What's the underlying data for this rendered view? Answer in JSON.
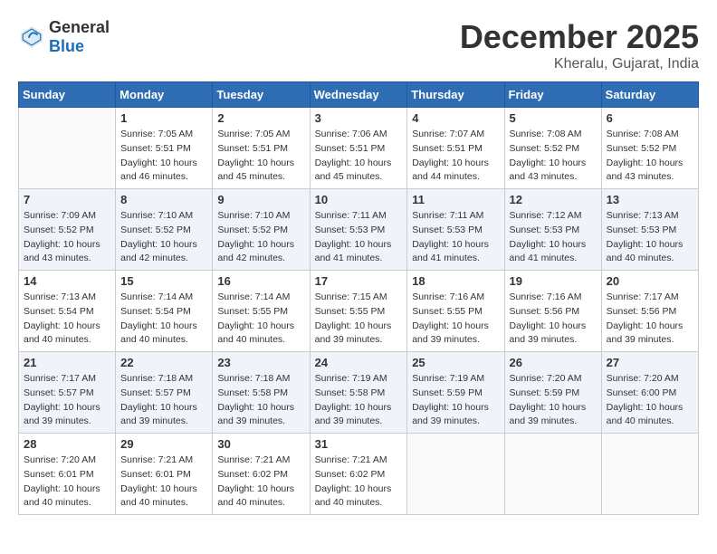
{
  "header": {
    "logo_general": "General",
    "logo_blue": "Blue",
    "month_year": "December 2025",
    "location": "Kheralu, Gujarat, India"
  },
  "days_of_week": [
    "Sunday",
    "Monday",
    "Tuesday",
    "Wednesday",
    "Thursday",
    "Friday",
    "Saturday"
  ],
  "weeks": [
    [
      {
        "day": "",
        "info": ""
      },
      {
        "day": "1",
        "info": "Sunrise: 7:05 AM\nSunset: 5:51 PM\nDaylight: 10 hours\nand 46 minutes."
      },
      {
        "day": "2",
        "info": "Sunrise: 7:05 AM\nSunset: 5:51 PM\nDaylight: 10 hours\nand 45 minutes."
      },
      {
        "day": "3",
        "info": "Sunrise: 7:06 AM\nSunset: 5:51 PM\nDaylight: 10 hours\nand 45 minutes."
      },
      {
        "day": "4",
        "info": "Sunrise: 7:07 AM\nSunset: 5:51 PM\nDaylight: 10 hours\nand 44 minutes."
      },
      {
        "day": "5",
        "info": "Sunrise: 7:08 AM\nSunset: 5:52 PM\nDaylight: 10 hours\nand 43 minutes."
      },
      {
        "day": "6",
        "info": "Sunrise: 7:08 AM\nSunset: 5:52 PM\nDaylight: 10 hours\nand 43 minutes."
      }
    ],
    [
      {
        "day": "7",
        "info": "Sunrise: 7:09 AM\nSunset: 5:52 PM\nDaylight: 10 hours\nand 43 minutes."
      },
      {
        "day": "8",
        "info": "Sunrise: 7:10 AM\nSunset: 5:52 PM\nDaylight: 10 hours\nand 42 minutes."
      },
      {
        "day": "9",
        "info": "Sunrise: 7:10 AM\nSunset: 5:52 PM\nDaylight: 10 hours\nand 42 minutes."
      },
      {
        "day": "10",
        "info": "Sunrise: 7:11 AM\nSunset: 5:53 PM\nDaylight: 10 hours\nand 41 minutes."
      },
      {
        "day": "11",
        "info": "Sunrise: 7:11 AM\nSunset: 5:53 PM\nDaylight: 10 hours\nand 41 minutes."
      },
      {
        "day": "12",
        "info": "Sunrise: 7:12 AM\nSunset: 5:53 PM\nDaylight: 10 hours\nand 41 minutes."
      },
      {
        "day": "13",
        "info": "Sunrise: 7:13 AM\nSunset: 5:53 PM\nDaylight: 10 hours\nand 40 minutes."
      }
    ],
    [
      {
        "day": "14",
        "info": "Sunrise: 7:13 AM\nSunset: 5:54 PM\nDaylight: 10 hours\nand 40 minutes."
      },
      {
        "day": "15",
        "info": "Sunrise: 7:14 AM\nSunset: 5:54 PM\nDaylight: 10 hours\nand 40 minutes."
      },
      {
        "day": "16",
        "info": "Sunrise: 7:14 AM\nSunset: 5:55 PM\nDaylight: 10 hours\nand 40 minutes."
      },
      {
        "day": "17",
        "info": "Sunrise: 7:15 AM\nSunset: 5:55 PM\nDaylight: 10 hours\nand 39 minutes."
      },
      {
        "day": "18",
        "info": "Sunrise: 7:16 AM\nSunset: 5:55 PM\nDaylight: 10 hours\nand 39 minutes."
      },
      {
        "day": "19",
        "info": "Sunrise: 7:16 AM\nSunset: 5:56 PM\nDaylight: 10 hours\nand 39 minutes."
      },
      {
        "day": "20",
        "info": "Sunrise: 7:17 AM\nSunset: 5:56 PM\nDaylight: 10 hours\nand 39 minutes."
      }
    ],
    [
      {
        "day": "21",
        "info": "Sunrise: 7:17 AM\nSunset: 5:57 PM\nDaylight: 10 hours\nand 39 minutes."
      },
      {
        "day": "22",
        "info": "Sunrise: 7:18 AM\nSunset: 5:57 PM\nDaylight: 10 hours\nand 39 minutes."
      },
      {
        "day": "23",
        "info": "Sunrise: 7:18 AM\nSunset: 5:58 PM\nDaylight: 10 hours\nand 39 minutes."
      },
      {
        "day": "24",
        "info": "Sunrise: 7:19 AM\nSunset: 5:58 PM\nDaylight: 10 hours\nand 39 minutes."
      },
      {
        "day": "25",
        "info": "Sunrise: 7:19 AM\nSunset: 5:59 PM\nDaylight: 10 hours\nand 39 minutes."
      },
      {
        "day": "26",
        "info": "Sunrise: 7:20 AM\nSunset: 5:59 PM\nDaylight: 10 hours\nand 39 minutes."
      },
      {
        "day": "27",
        "info": "Sunrise: 7:20 AM\nSunset: 6:00 PM\nDaylight: 10 hours\nand 40 minutes."
      }
    ],
    [
      {
        "day": "28",
        "info": "Sunrise: 7:20 AM\nSunset: 6:01 PM\nDaylight: 10 hours\nand 40 minutes."
      },
      {
        "day": "29",
        "info": "Sunrise: 7:21 AM\nSunset: 6:01 PM\nDaylight: 10 hours\nand 40 minutes."
      },
      {
        "day": "30",
        "info": "Sunrise: 7:21 AM\nSunset: 6:02 PM\nDaylight: 10 hours\nand 40 minutes."
      },
      {
        "day": "31",
        "info": "Sunrise: 7:21 AM\nSunset: 6:02 PM\nDaylight: 10 hours\nand 40 minutes."
      },
      {
        "day": "",
        "info": ""
      },
      {
        "day": "",
        "info": ""
      },
      {
        "day": "",
        "info": ""
      }
    ]
  ]
}
